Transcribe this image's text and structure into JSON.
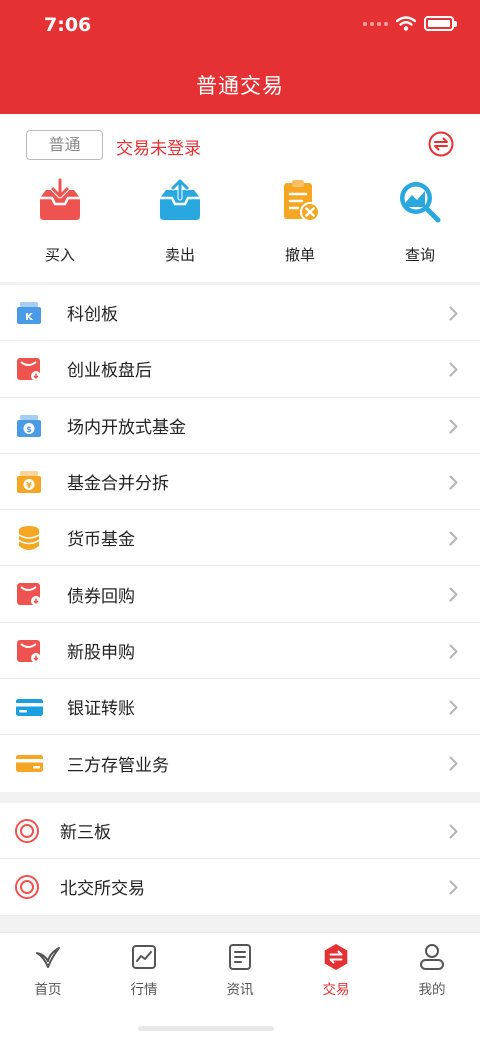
{
  "status_bar": {
    "time": "7:06"
  },
  "header": {
    "title": "普通交易"
  },
  "account": {
    "mode_tag": "普通",
    "login_status": "交易未登录"
  },
  "actions": [
    {
      "label": "买入",
      "icon": "buy-icon",
      "color": "#ef5350"
    },
    {
      "label": "卖出",
      "icon": "sell-icon",
      "color": "#29a8e0"
    },
    {
      "label": "撤单",
      "icon": "cancel-order-icon",
      "color": "#f5a623"
    },
    {
      "label": "查询",
      "icon": "query-icon",
      "color": "#29a8e0"
    }
  ],
  "menu_main": [
    {
      "label": "科创板",
      "icon": "star-market-icon",
      "color": "#4a9be6"
    },
    {
      "label": "创业板盘后",
      "icon": "gem-after-hours-icon",
      "color": "#ef5350"
    },
    {
      "label": "场内开放式基金",
      "icon": "listed-open-fund-icon",
      "color": "#4a9be6"
    },
    {
      "label": "基金合并分拆",
      "icon": "fund-merge-split-icon",
      "color": "#f5a623"
    },
    {
      "label": "货币基金",
      "icon": "money-fund-icon",
      "color": "#f5a623"
    },
    {
      "label": "债券回购",
      "icon": "bond-repo-icon",
      "color": "#ef5350"
    },
    {
      "label": "新股申购",
      "icon": "ipo-subscribe-icon",
      "color": "#ef5350"
    },
    {
      "label": "银证转账",
      "icon": "bank-transfer-icon",
      "color": "#1a9fe0"
    },
    {
      "label": "三方存管业务",
      "icon": "third-party-custody-icon",
      "color": "#f5a623"
    }
  ],
  "menu_third": [
    {
      "label": "新三板",
      "icon": "neeq-icon",
      "color": "#ef5350"
    },
    {
      "label": "北交所交易",
      "icon": "bse-icon",
      "color": "#ef5350"
    }
  ],
  "tabbar": [
    {
      "label": "首页",
      "icon": "home-icon",
      "active": false
    },
    {
      "label": "行情",
      "icon": "market-icon",
      "active": false
    },
    {
      "label": "资讯",
      "icon": "news-icon",
      "active": false
    },
    {
      "label": "交易",
      "icon": "trade-icon",
      "active": true
    },
    {
      "label": "我的",
      "icon": "profile-icon",
      "active": false
    }
  ],
  "colors": {
    "brand": "#e63134",
    "text": "#222222",
    "muted": "#888888"
  }
}
